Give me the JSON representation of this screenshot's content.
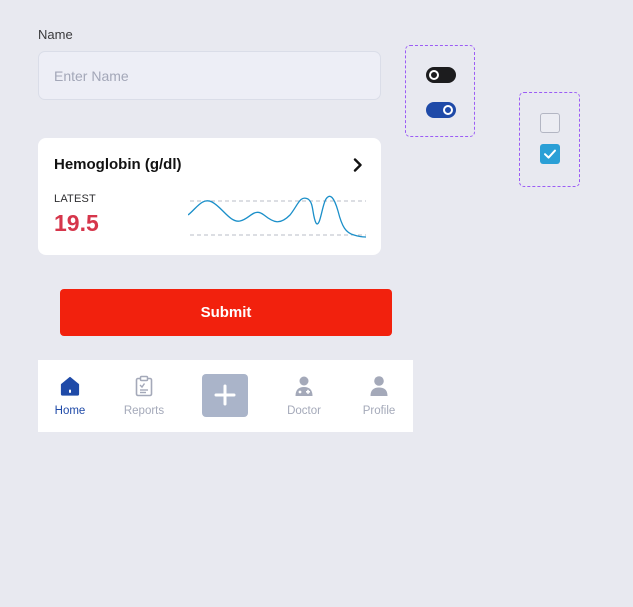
{
  "form": {
    "name_label": "Name",
    "name_placeholder": "Enter Name",
    "name_value": ""
  },
  "toggles": [
    {
      "state": "off"
    },
    {
      "state": "on"
    }
  ],
  "checkboxes": [
    {
      "checked": false
    },
    {
      "checked": true
    }
  ],
  "card": {
    "title": "Hemoglobin (g/dl)",
    "latest_label": "LATEST",
    "latest_value": "19.5",
    "chevron_icon": "chevron-right-icon"
  },
  "submit": {
    "label": "Submit"
  },
  "nav": {
    "items": [
      {
        "label": "Home",
        "icon": "home-icon",
        "active": true
      },
      {
        "label": "Reports",
        "icon": "clipboard-icon",
        "active": false
      },
      {
        "label": "",
        "icon": "plus-icon",
        "active": false
      },
      {
        "label": "Doctor",
        "icon": "doctor-icon",
        "active": false
      },
      {
        "label": "Profile",
        "icon": "user-icon",
        "active": false
      }
    ]
  },
  "colors": {
    "background": "#e8e9f0",
    "accent_blue": "#1f4aa8",
    "submit_red": "#f2210d",
    "value_red": "#d6364b",
    "checkbox_blue": "#2a9fd6",
    "sparkline": "#1b8fc9",
    "dashed_outline": "#9b5cf5"
  }
}
